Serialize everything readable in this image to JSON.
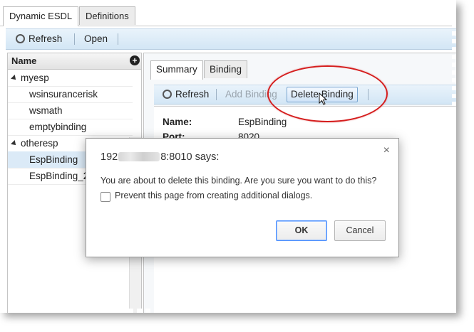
{
  "window": {
    "tabs": [
      "Dynamic ESDL",
      "Definitions"
    ]
  },
  "toolbar": {
    "refresh_label": "Refresh",
    "open_label": "Open"
  },
  "tree": {
    "header": "Name",
    "add_icon": "+",
    "groups": [
      {
        "label": "myesp",
        "children": [
          "wsinsurancerisk",
          "wsmath",
          "emptybinding"
        ]
      },
      {
        "label": "otheresp",
        "children": [
          "EspBinding",
          "EspBinding_2"
        ]
      }
    ]
  },
  "detail": {
    "tabs": [
      "Summary",
      "Binding"
    ],
    "toolbar": {
      "refresh_label": "Refresh",
      "add_binding_label": "Add Binding",
      "delete_binding_label": "Delete Binding"
    },
    "fields": [
      {
        "label": "Name:",
        "value": "EspBinding"
      },
      {
        "label": "Port:",
        "value": "8020"
      }
    ]
  },
  "dialog": {
    "title_prefix": "192",
    "title_suffix": "8:8010 says:",
    "message": "You are about to delete this binding. Are you sure you want to do this?",
    "checkbox_label": "Prevent this page from creating additional dialogs.",
    "ok_label": "OK",
    "cancel_label": "Cancel",
    "close_glyph": "×"
  },
  "colors": {
    "toolbar_blue": "#d3e6f5",
    "selection": "#dbeaf7",
    "annotation_red": "#d51e1e",
    "focus_blue": "#4d90fe"
  },
  "icons": [
    "refresh-icon",
    "add-icon",
    "caret-down-icon",
    "close-icon",
    "mouse-cursor-icon"
  ]
}
